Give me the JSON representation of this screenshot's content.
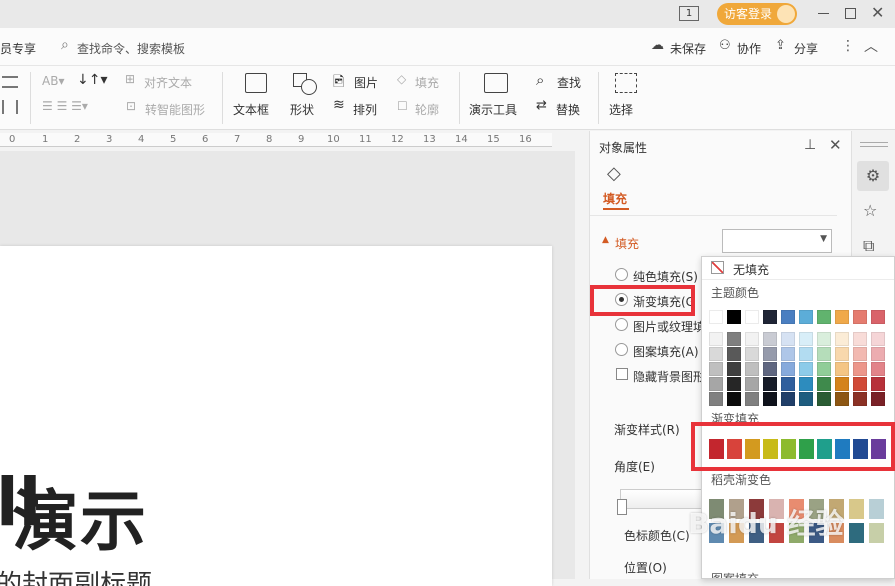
{
  "titlebar": {
    "page_indicator": "1",
    "guest_login": "访客登录",
    "window_buttons": [
      "minimize-icon",
      "restore-icon",
      "close-icon"
    ]
  },
  "topbar": {
    "member_label": "员专享",
    "search_placeholder": "查找命令、搜索模板",
    "unsaved": "未保存",
    "collab": "协作",
    "share": "分享"
  },
  "ribbon": {
    "align_text": "对齐文本",
    "smart_shape": "转智能图形",
    "textbox": "文本框",
    "shape": "形状",
    "picture": "图片",
    "fill": "填充",
    "arrange": "排列",
    "outline": "轮廓",
    "present_tools": "演示工具",
    "find": "查找",
    "replace": "替换",
    "select": "选择"
  },
  "ruler": {
    "ticks": [
      "0",
      "1",
      "2",
      "3",
      "4",
      "5",
      "6",
      "7",
      "8",
      "9",
      "10",
      "11",
      "12",
      "13",
      "14",
      "15",
      "16"
    ]
  },
  "slide": {
    "title": "演示",
    "title_partial": "ll",
    "subtitle_partial": "的封面副标题"
  },
  "panel": {
    "header": "对象属性",
    "tab_fill": "填充",
    "section_fill": "填充",
    "options": [
      {
        "label": "纯色填充(S)",
        "selected": false
      },
      {
        "label": "渐变填充(G",
        "selected": true
      },
      {
        "label": "图片或纹理填",
        "selected": false
      },
      {
        "label": "图案填充(A)",
        "selected": false
      }
    ],
    "hide_bg": "隐藏背景图形",
    "gradient_style": "渐变样式(R)",
    "angle": "角度(E)",
    "stop_color": "色标颜色(C)",
    "position": "位置(O)"
  },
  "popup": {
    "no_fill": "无填充",
    "theme_colors": "主题颜色",
    "gradient_fill": "渐变填充",
    "shell_gradient": "稻壳渐变色",
    "pattern_fill": "图案填充",
    "theme_top_row": [
      "#ffffff",
      "#000000",
      "#ffffff",
      "#1f2535",
      "#4a7fc1",
      "#5cadd8",
      "#61b36e",
      "#f0a94a",
      "#e57c6f",
      "#d9636a"
    ],
    "theme_tints": [
      [
        "#f2f2f2",
        "#7f7f7f",
        "#f2f2f2",
        "#c9cbd3",
        "#d6e2f3",
        "#d8eef8",
        "#d9eedc",
        "#fbecd6",
        "#f8dcd8",
        "#f5d5d7"
      ],
      [
        "#d9d9d9",
        "#595959",
        "#d9d9d9",
        "#959aab",
        "#aec6e8",
        "#b2dcf1",
        "#b5ddba",
        "#f8d8ad",
        "#f2b9b1",
        "#ecacb0"
      ],
      [
        "#bfbfbf",
        "#404040",
        "#bfbfbf",
        "#5f6680",
        "#86aadc",
        "#8ccbe9",
        "#90cd98",
        "#f4c585",
        "#ec968a",
        "#e28389"
      ],
      [
        "#a6a6a6",
        "#262626",
        "#a6a6a6",
        "#161b28",
        "#2f5f9d",
        "#2d8cbe",
        "#3f8a4c",
        "#d4831c",
        "#d04a37",
        "#b7313a"
      ],
      [
        "#808080",
        "#0d0d0d",
        "#808080",
        "#0f121b",
        "#203f69",
        "#1e5d7f",
        "#2a5c33",
        "#8d5713",
        "#8b3125",
        "#7a2127"
      ]
    ],
    "gradient_swatches": [
      "#c3262e",
      "#d8433b",
      "#d39a1f",
      "#c8bb18",
      "#8dbb2e",
      "#2fa04a",
      "#1f9f8c",
      "#1f7bc0",
      "#214a93",
      "#6a3c9c"
    ],
    "shell_row1": [
      "#7e8b73",
      "#b0a08c",
      "#8c3a3a",
      "#d9b3b0",
      "#e88c70",
      "#9aa284",
      "#c2a873",
      "#d8c88a",
      "#b8cfd6"
    ],
    "shell_row2": [
      "#5f8ab0",
      "#d39a55",
      "#3f5f83",
      "#c24540",
      "#8faa6a",
      "#3c5a85",
      "#d98c5f",
      "#2e6b7e",
      "#c7cfa8"
    ]
  },
  "watermark": "Baidu 经验"
}
